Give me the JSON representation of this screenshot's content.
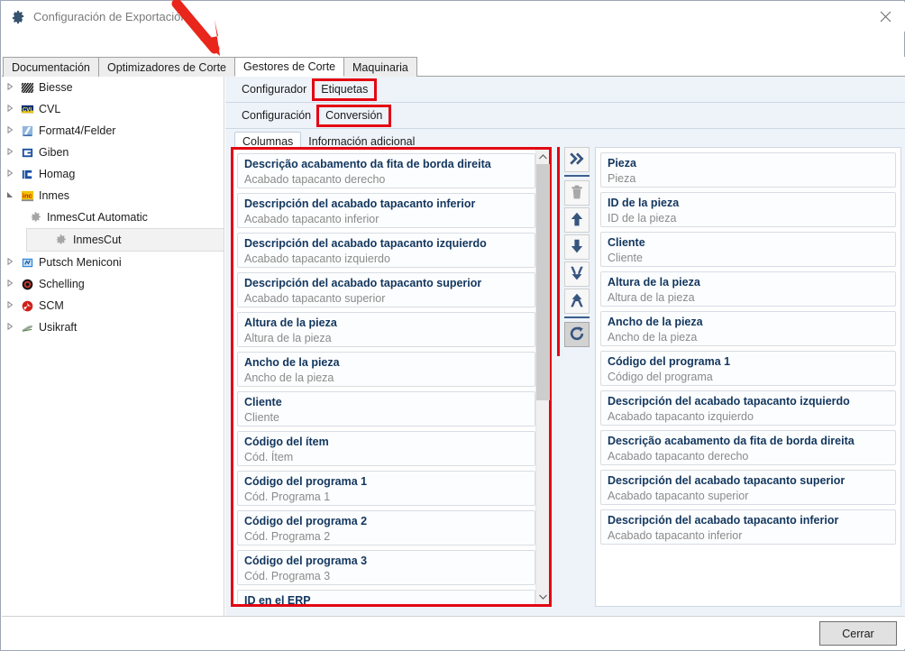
{
  "window": {
    "title": "Configuración de Exportación",
    "gear_icon": "gear-icon",
    "close_icon": "close-icon"
  },
  "top_tabs": [
    {
      "label": "Documentación",
      "selected": false
    },
    {
      "label": "Optimizadores de Corte",
      "selected": false
    },
    {
      "label": "Gestores de Corte",
      "selected": true
    },
    {
      "label": "Maquinaria",
      "selected": false
    }
  ],
  "tree": [
    {
      "label": "Biesse",
      "icon": "biesse-logo-icon",
      "expandable": true,
      "expanded": false,
      "level": 0,
      "selected": false
    },
    {
      "label": "CVL",
      "icon": "cvl-logo-icon",
      "expandable": true,
      "expanded": false,
      "level": 0,
      "selected": false
    },
    {
      "label": "Format4/Felder",
      "icon": "format4-logo-icon",
      "expandable": true,
      "expanded": false,
      "level": 0,
      "selected": false
    },
    {
      "label": "Giben",
      "icon": "giben-logo-icon",
      "expandable": true,
      "expanded": false,
      "level": 0,
      "selected": false
    },
    {
      "label": "Homag",
      "icon": "homag-logo-icon",
      "expandable": true,
      "expanded": false,
      "level": 0,
      "selected": false
    },
    {
      "label": "Inmes",
      "icon": "inmes-logo-icon",
      "expandable": true,
      "expanded": true,
      "level": 0,
      "selected": false
    },
    {
      "label": "InmesCut Automatic",
      "icon": "gear-icon",
      "expandable": false,
      "expanded": false,
      "level": 1,
      "selected": false
    },
    {
      "label": "InmesCut",
      "icon": "gear-icon",
      "expandable": false,
      "expanded": false,
      "level": 1,
      "selected": true
    },
    {
      "label": "Putsch Meniconi",
      "icon": "putsch-logo-icon",
      "expandable": true,
      "expanded": false,
      "level": 0,
      "selected": false
    },
    {
      "label": "Schelling",
      "icon": "schelling-logo-icon",
      "expandable": true,
      "expanded": false,
      "level": 0,
      "selected": false
    },
    {
      "label": "SCM",
      "icon": "scm-logo-icon",
      "expandable": true,
      "expanded": false,
      "level": 0,
      "selected": false
    },
    {
      "label": "Usikraft",
      "icon": "usikraft-logo-icon",
      "expandable": true,
      "expanded": false,
      "level": 0,
      "selected": false
    }
  ],
  "subbar1": [
    {
      "label": "Configurador",
      "highlighted": false
    },
    {
      "label": "Etiquetas",
      "highlighted": true
    }
  ],
  "subbar2": [
    {
      "label": "Configuración",
      "highlighted": false
    },
    {
      "label": "Conversión",
      "highlighted": true
    }
  ],
  "tabs3": [
    {
      "label": "Columnas",
      "selected": true
    },
    {
      "label": "Información adicional",
      "selected": false
    }
  ],
  "left_list": [
    {
      "title": "Descrição acabamento da fita de borda direita",
      "sub": "Acabado tapacanto derecho"
    },
    {
      "title": "Descripción del acabado tapacanto inferior",
      "sub": "Acabado tapacanto inferior"
    },
    {
      "title": "Descripción del acabado tapacanto izquierdo",
      "sub": "Acabado tapacanto izquierdo"
    },
    {
      "title": "Descripción del acabado tapacanto superior",
      "sub": "Acabado tapacanto superior"
    },
    {
      "title": "Altura de la pieza",
      "sub": "Altura de la pieza"
    },
    {
      "title": "Ancho de la pieza",
      "sub": "Ancho de la pieza"
    },
    {
      "title": "Cliente",
      "sub": "Cliente"
    },
    {
      "title": "Código del ítem",
      "sub": "Cód. Ítem"
    },
    {
      "title": "Código del programa 1",
      "sub": "Cód. Programa 1"
    },
    {
      "title": "Código del programa 2",
      "sub": "Cód. Programa 2"
    },
    {
      "title": "Código del programa 3",
      "sub": "Cód. Programa 3"
    },
    {
      "title": "ID en el ERP",
      "sub": ""
    }
  ],
  "right_list": [
    {
      "title": "Pieza",
      "sub": "Pieza"
    },
    {
      "title": "ID de la pieza",
      "sub": "ID de la pieza"
    },
    {
      "title": "Cliente",
      "sub": "Cliente"
    },
    {
      "title": "Altura de la pieza",
      "sub": "Altura de la pieza"
    },
    {
      "title": "Ancho de la pieza",
      "sub": "Ancho de la pieza"
    },
    {
      "title": "Código del programa 1",
      "sub": "Código del programa"
    },
    {
      "title": "Descripción del acabado tapacanto izquierdo",
      "sub": "Acabado tapacanto izquierdo"
    },
    {
      "title": "Descrição acabamento da fita de borda direita",
      "sub": "Acabado tapacanto derecho"
    },
    {
      "title": "Descripción del acabado tapacanto superior",
      "sub": "Acabado tapacanto superior"
    },
    {
      "title": "Descripción del acabado tapacanto inferior",
      "sub": "Acabado tapacanto inferior"
    }
  ],
  "mid_buttons": [
    {
      "icon": "double-chevron-right-icon",
      "active": false,
      "sep_after": true
    },
    {
      "icon": "trash-icon",
      "active": false,
      "sep_after": false
    },
    {
      "icon": "arrow-up-icon",
      "active": false,
      "sep_after": false
    },
    {
      "icon": "arrow-down-icon",
      "active": false,
      "sep_after": false
    },
    {
      "icon": "merge-down-icon",
      "active": false,
      "sep_after": false
    },
    {
      "icon": "split-up-icon",
      "active": false,
      "sep_after": true
    },
    {
      "icon": "refresh-icon",
      "active": true,
      "sep_after": false
    }
  ],
  "footer": {
    "close_label": "Cerrar"
  },
  "colors": {
    "highlight_red": "#e30613",
    "card_title": "#12365e",
    "card_sub": "#8a8a8a",
    "pane_bg": "#eef3f9"
  }
}
